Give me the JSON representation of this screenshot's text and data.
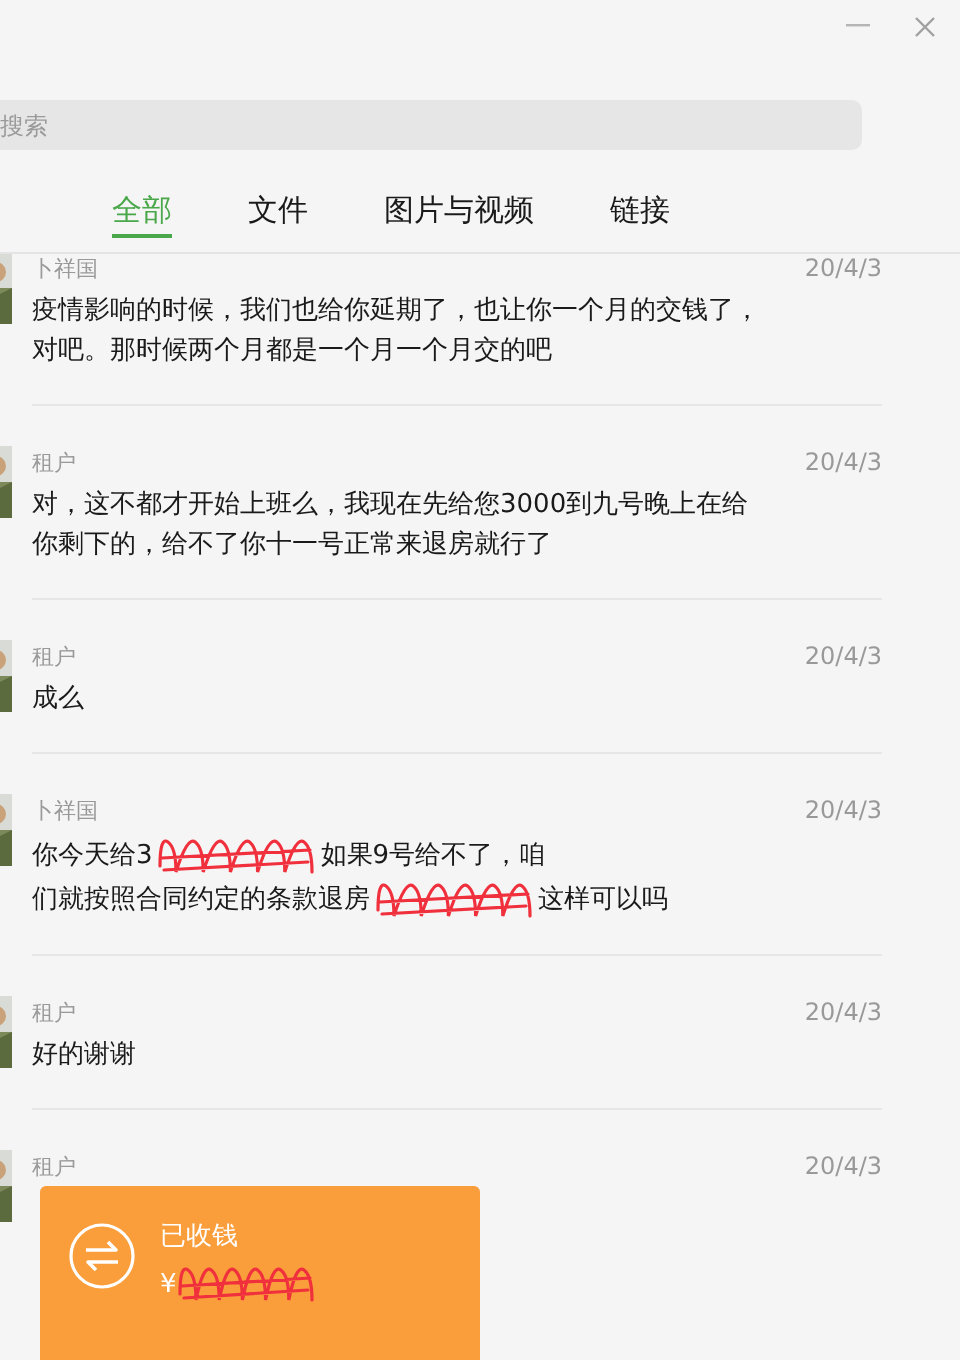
{
  "search": {
    "placeholder": "搜索"
  },
  "tabs": [
    {
      "label": "全部",
      "selected": true
    },
    {
      "label": "文件",
      "selected": false
    },
    {
      "label": "图片与视频",
      "selected": false
    },
    {
      "label": "链接",
      "selected": false
    }
  ],
  "messages": [
    {
      "kind": "text",
      "sender": "卜祥国",
      "date": "20/4/3",
      "parts": [
        {
          "kind": "text",
          "text": "疫情影响的时候，我们也给你延期了，也让你一个月的交钱了，对吧。那时候两个月都是一个月一个月交的吧"
        }
      ]
    },
    {
      "kind": "text",
      "sender": "租户",
      "date": "20/4/3",
      "parts": [
        {
          "kind": "text",
          "text": "对，这不都才开始上班么，我现在先给您3000到九号晚上在给你剩下的，给不了你十一号正常来退房就行了"
        }
      ]
    },
    {
      "kind": "text",
      "sender": "租户",
      "date": "20/4/3",
      "parts": [
        {
          "kind": "text",
          "text": "成么"
        }
      ]
    },
    {
      "kind": "text",
      "sender": "卜祥国",
      "date": "20/4/3",
      "parts": [
        {
          "kind": "text",
          "text": "你今天给3"
        },
        {
          "kind": "scribble"
        },
        {
          "kind": "text",
          "text": "如果9号给不了，咱"
        },
        {
          "kind": "break"
        },
        {
          "kind": "text",
          "text": "们就按照合同约定的条款退房"
        },
        {
          "kind": "scribble"
        },
        {
          "kind": "text",
          "text": "这样可以吗"
        }
      ]
    },
    {
      "kind": "text",
      "sender": "租户",
      "date": "20/4/3",
      "parts": [
        {
          "kind": "text",
          "text": "好的谢谢"
        }
      ]
    },
    {
      "kind": "transfer",
      "sender": "租户",
      "date": "20/4/3",
      "status": "已收钱",
      "amount": [
        {
          "kind": "text",
          "text": "¥"
        },
        {
          "kind": "scribble"
        }
      ]
    }
  ]
}
